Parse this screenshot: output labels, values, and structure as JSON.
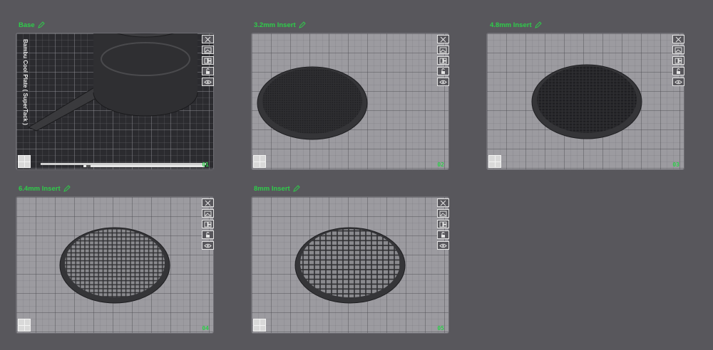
{
  "plates": [
    {
      "title": "Base",
      "number": "01",
      "plate_label": "Bambu Cool Plate ( SuperTack )"
    },
    {
      "title": "3.2mm Insert",
      "number": "02"
    },
    {
      "title": "4.8mm Insert",
      "number": "03"
    },
    {
      "title": "6.4mm Insert",
      "number": "04"
    },
    {
      "title": "8mm Insert",
      "number": "05"
    }
  ],
  "toolbar_icons": [
    "close-icon",
    "image-icon",
    "arrange-icon",
    "lock-icon",
    "eye-icon"
  ],
  "colors": {
    "accent": "#2ecc4a",
    "background": "#58575c",
    "plate": "#9c9ba0",
    "dark_plate": "#2b2b2f",
    "model": "#2a2a2c"
  }
}
